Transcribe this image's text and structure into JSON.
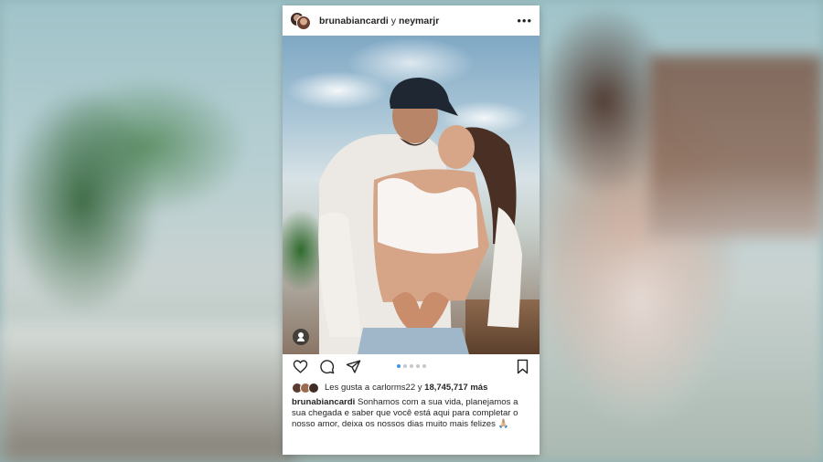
{
  "post": {
    "header": {
      "user1": "brunabiancardi",
      "connector": " y ",
      "user2": "neymarjr",
      "more": "•••"
    },
    "carousel": {
      "count": 5,
      "active_index": 0
    },
    "likes": {
      "prefix": "Les gusta a ",
      "user": "carlorms22",
      "connector": " y ",
      "count_text": "18,745,717 más"
    },
    "caption": {
      "username": "brunabiancardi",
      "text": " Sonhamos com a sua vida, planejamos a sua chegada e saber que você está aqui para completar o nosso amor, deixa os nossos dias muito mais felizes 🙏🏼"
    },
    "icons": {
      "more": "more-horizontal-icon",
      "like": "heart-icon",
      "comment": "comment-icon",
      "share": "send-icon",
      "save": "bookmark-icon",
      "tag": "user-tag-icon"
    },
    "colors": {
      "accent_dot": "#3897f0",
      "text": "#262626"
    }
  }
}
